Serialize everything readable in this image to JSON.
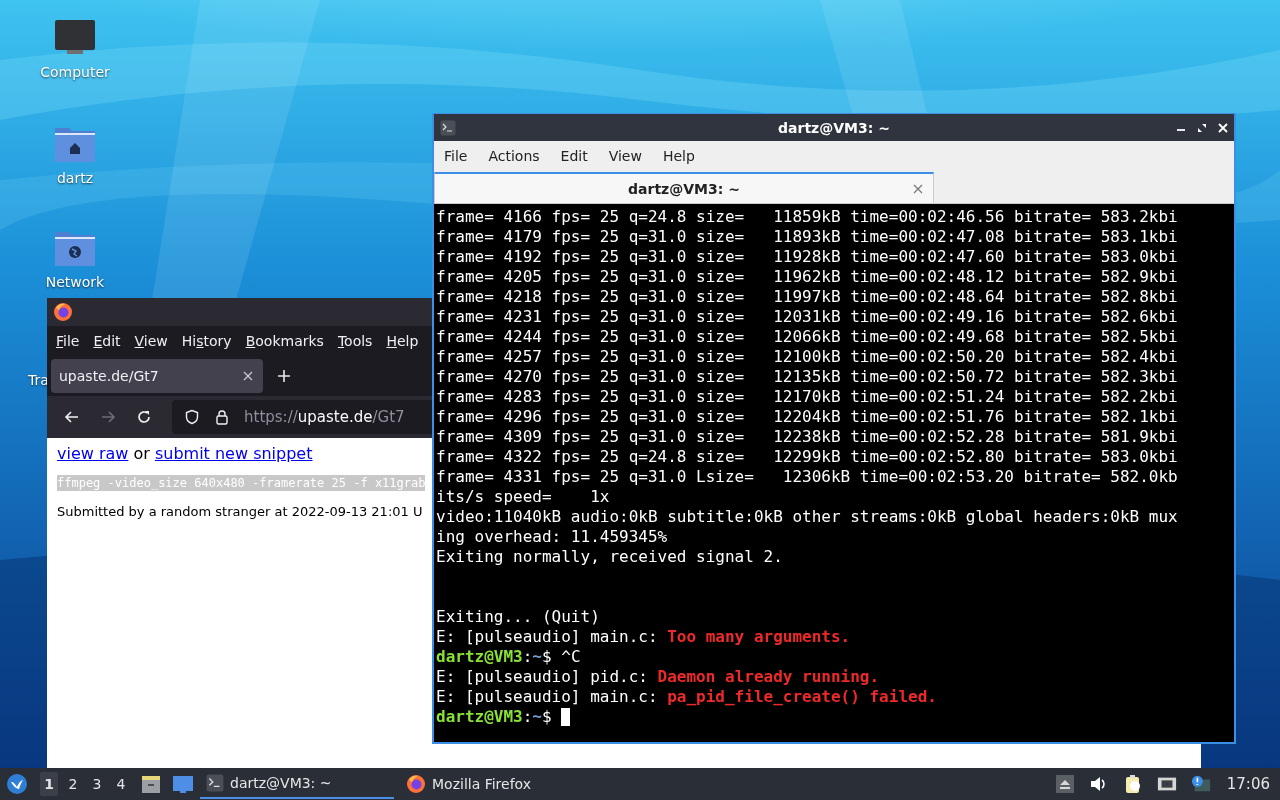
{
  "desktop": {
    "icons": [
      {
        "kind": "computer",
        "label": "Computer"
      },
      {
        "kind": "home",
        "label": "dartz"
      },
      {
        "kind": "network",
        "label": "Network"
      },
      {
        "kind": "trash",
        "label": "Tra"
      }
    ]
  },
  "firefox": {
    "menu": [
      {
        "parts": [
          {
            "text": "F",
            "underlined": true
          },
          {
            "text": "ile",
            "underlined": false
          }
        ]
      },
      {
        "parts": [
          {
            "text": "E",
            "underlined": true
          },
          {
            "text": "dit",
            "underlined": false
          }
        ]
      },
      {
        "parts": [
          {
            "text": "V",
            "underlined": true
          },
          {
            "text": "iew",
            "underlined": false
          }
        ]
      },
      {
        "parts": [
          {
            "text": "Hi",
            "underlined": false
          },
          {
            "text": "s",
            "underlined": true
          },
          {
            "text": "tory",
            "underlined": false
          }
        ]
      },
      {
        "parts": [
          {
            "text": "B",
            "underlined": true
          },
          {
            "text": "ookmarks",
            "underlined": false
          }
        ]
      },
      {
        "parts": [
          {
            "text": "T",
            "underlined": true
          },
          {
            "text": "ools",
            "underlined": false
          }
        ]
      },
      {
        "parts": [
          {
            "text": "H",
            "underlined": true
          },
          {
            "text": "elp",
            "underlined": false
          }
        ]
      }
    ],
    "tabs": [
      {
        "title": "upaste.de/Gt7",
        "selected": true
      }
    ],
    "forward_enabled": false,
    "url": {
      "scheme": "https://",
      "host": "upaste.de",
      "path": "/Gt7"
    },
    "page": {
      "actions": [
        {
          "kind": "link",
          "text": "view raw"
        },
        {
          "kind": "text",
          "text": "or"
        },
        {
          "kind": "link",
          "text": "submit new snippet"
        }
      ],
      "code": "ffmpeg -video_size 640x480 -framerate 25 -f x11grab",
      "submitted": "Submitted by a random stranger at 2022-09-13 21:01 U"
    }
  },
  "terminal": {
    "title": "dartz@VM3: ~",
    "menu": [
      "File",
      "Actions",
      "Edit",
      "View",
      "Help"
    ],
    "tabs": [
      {
        "title": "dartz@VM3: ~",
        "selected": true
      }
    ],
    "cursor_visible": true,
    "lines": [
      {
        "kind": "text",
        "segments": [
          {
            "kind": "plain",
            "text": "frame= 4166 fps= 25 q=24.8 size=   11859kB time=00:02:46.56 bitrate= 583.2kbi"
          }
        ]
      },
      {
        "kind": "text",
        "segments": [
          {
            "kind": "plain",
            "text": "frame= 4179 fps= 25 q=31.0 size=   11893kB time=00:02:47.08 bitrate= 583.1kbi"
          }
        ]
      },
      {
        "kind": "text",
        "segments": [
          {
            "kind": "plain",
            "text": "frame= 4192 fps= 25 q=31.0 size=   11928kB time=00:02:47.60 bitrate= 583.0kbi"
          }
        ]
      },
      {
        "kind": "text",
        "segments": [
          {
            "kind": "plain",
            "text": "frame= 4205 fps= 25 q=31.0 size=   11962kB time=00:02:48.12 bitrate= 582.9kbi"
          }
        ]
      },
      {
        "kind": "text",
        "segments": [
          {
            "kind": "plain",
            "text": "frame= 4218 fps= 25 q=31.0 size=   11997kB time=00:02:48.64 bitrate= 582.8kbi"
          }
        ]
      },
      {
        "kind": "text",
        "segments": [
          {
            "kind": "plain",
            "text": "frame= 4231 fps= 25 q=31.0 size=   12031kB time=00:02:49.16 bitrate= 582.6kbi"
          }
        ]
      },
      {
        "kind": "text",
        "segments": [
          {
            "kind": "plain",
            "text": "frame= 4244 fps= 25 q=31.0 size=   12066kB time=00:02:49.68 bitrate= 582.5kbi"
          }
        ]
      },
      {
        "kind": "text",
        "segments": [
          {
            "kind": "plain",
            "text": "frame= 4257 fps= 25 q=31.0 size=   12100kB time=00:02:50.20 bitrate= 582.4kbi"
          }
        ]
      },
      {
        "kind": "text",
        "segments": [
          {
            "kind": "plain",
            "text": "frame= 4270 fps= 25 q=31.0 size=   12135kB time=00:02:50.72 bitrate= 582.3kbi"
          }
        ]
      },
      {
        "kind": "text",
        "segments": [
          {
            "kind": "plain",
            "text": "frame= 4283 fps= 25 q=31.0 size=   12170kB time=00:02:51.24 bitrate= 582.2kbi"
          }
        ]
      },
      {
        "kind": "text",
        "segments": [
          {
            "kind": "plain",
            "text": "frame= 4296 fps= 25 q=31.0 size=   12204kB time=00:02:51.76 bitrate= 582.1kbi"
          }
        ]
      },
      {
        "kind": "text",
        "segments": [
          {
            "kind": "plain",
            "text": "frame= 4309 fps= 25 q=31.0 size=   12238kB time=00:02:52.28 bitrate= 581.9kbi"
          }
        ]
      },
      {
        "kind": "text",
        "segments": [
          {
            "kind": "plain",
            "text": "frame= 4322 fps= 25 q=24.8 size=   12299kB time=00:02:52.80 bitrate= 583.0kbi"
          }
        ]
      },
      {
        "kind": "text",
        "segments": [
          {
            "kind": "plain",
            "text": "frame= 4331 fps= 25 q=31.0 Lsize=   12306kB time=00:02:53.20 bitrate= 582.0kb"
          }
        ]
      },
      {
        "kind": "text",
        "segments": [
          {
            "kind": "plain",
            "text": "its/s speed=    1x"
          }
        ]
      },
      {
        "kind": "text",
        "segments": [
          {
            "kind": "plain",
            "text": "video:11040kB audio:0kB subtitle:0kB other streams:0kB global headers:0kB mux"
          }
        ]
      },
      {
        "kind": "text",
        "segments": [
          {
            "kind": "plain",
            "text": "ing overhead: 11.459345%"
          }
        ]
      },
      {
        "kind": "text",
        "segments": [
          {
            "kind": "plain",
            "text": "Exiting normally, received signal 2."
          }
        ]
      },
      {
        "kind": "blank"
      },
      {
        "kind": "blank"
      },
      {
        "kind": "text",
        "segments": [
          {
            "kind": "plain",
            "text": "Exiting... (Quit)"
          }
        ]
      },
      {
        "kind": "text",
        "segments": [
          {
            "kind": "plain",
            "text": "E: [pulseaudio] main.c: "
          },
          {
            "kind": "error",
            "text": "Too many arguments."
          }
        ]
      },
      {
        "kind": "text",
        "segments": [
          {
            "kind": "user",
            "text": "dartz@VM3"
          },
          {
            "kind": "plain",
            "text": ":"
          },
          {
            "kind": "path",
            "text": "~"
          },
          {
            "kind": "plain",
            "text": "$ ^C"
          }
        ]
      },
      {
        "kind": "text",
        "segments": [
          {
            "kind": "plain",
            "text": "E: [pulseaudio] pid.c: "
          },
          {
            "kind": "error",
            "text": "Daemon already running."
          }
        ]
      },
      {
        "kind": "text",
        "segments": [
          {
            "kind": "plain",
            "text": "E: [pulseaudio] main.c: "
          },
          {
            "kind": "error",
            "text": "pa_pid_file_create() failed."
          }
        ]
      },
      {
        "kind": "text",
        "segments": [
          {
            "kind": "user",
            "text": "dartz@VM3"
          },
          {
            "kind": "plain",
            "text": ":"
          },
          {
            "kind": "path",
            "text": "~"
          },
          {
            "kind": "plain",
            "text": "$ "
          }
        ]
      }
    ]
  },
  "taskbar": {
    "workspaces": [
      {
        "label": "1",
        "selected": true
      },
      {
        "label": "2",
        "selected": false
      },
      {
        "label": "3",
        "selected": false
      },
      {
        "label": "4",
        "selected": false
      }
    ],
    "tasks": [
      {
        "kind": "terminal",
        "label": "dartz@VM3: ~",
        "selected": true
      },
      {
        "kind": "firefox",
        "label": "Mozilla Firefox",
        "selected": false
      }
    ],
    "clock": "17:06"
  }
}
